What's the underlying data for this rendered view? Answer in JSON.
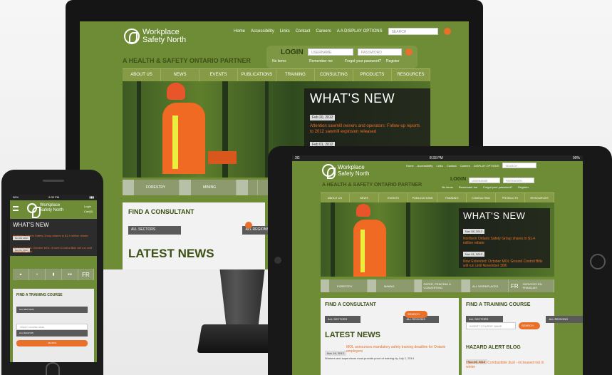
{
  "site": {
    "logo_line1": "Workplace",
    "logo_line2": "Safety North",
    "toplinks": [
      "Home",
      "Accessibility",
      "Links",
      "Contact",
      "Careers"
    ],
    "display_options": "DISPLAY OPTIONS",
    "search_placeholder": "SEARCH",
    "tagline": "A HEALTH & SAFETY ONTARIO PARTNER",
    "login": "LOGIN",
    "username": "USERNAME",
    "password": "PASSWORD",
    "no_items": "No items",
    "remember": "Remember me",
    "forgot": "Forgot your password?",
    "register": "Register",
    "nav": [
      "ABOUT US",
      "NEWS",
      "EVENTS",
      "PUBLICATIONS",
      "TRAINING",
      "CONSULTING",
      "PRODUCTS",
      "RESOURCES"
    ],
    "whats_new": "WHAT'S NEW",
    "news": [
      {
        "date": "Feb 20, 2012",
        "text": "Attention sawmill owners and operators: Follow-up reports to 2012 sawmill explosion released"
      },
      {
        "date": "Feb 01, 2012",
        "text": ""
      }
    ],
    "tablet_news": [
      {
        "date": "Nov 08, 2012",
        "text": "Northern Ontario Safety Group shares in $1.4 million rebate"
      },
      {
        "date": "Nov 01, 2012",
        "text": "Now Extended: October MOL Ground Control Blitz will run until November 30th"
      }
    ],
    "categories": [
      "FORESTRY",
      "MINING",
      "PAPER, PRINTING & CONVERTING",
      "ALL WORKPLACES",
      "SERVICES EN FRANÇAIS"
    ],
    "fr": "FR",
    "consultant_title": "FIND A CONSULTANT",
    "all_sectors": "ALL SECTORS",
    "all_regions": "ALL REGIONS",
    "search_btn": "SEARCH",
    "training_title": "FIND A TRAINING COURSE",
    "course_name": "INSERT COURSE NAME",
    "latest_news": "LATEST NEWS",
    "latest_item": {
      "date": "Nov 16, 2012",
      "text": "MOL announces mandatory safety training deadline for Ontario employers",
      "sub": "Workers and supervisors must provide proof of training by July 1, 2014"
    },
    "hazard_title": "HAZARD ALERT BLOG",
    "hazard_item": {
      "date": "Nov 06, 2012",
      "text": "Hazard Alert: Combustible dust - increased risk in winter"
    },
    "status_tablet": {
      "carrier": "3G",
      "time": "8:33 PM",
      "battery": "90%"
    },
    "status_phone": {
      "carrier": "96%",
      "time": "8:33 PM"
    },
    "phone_links": [
      "Login",
      "Cart(0)"
    ]
  },
  "colors": {
    "site_green": "#6e8b36",
    "accent_orange": "#e8702a",
    "dark_green": "#3d5016"
  },
  "icons": [
    "search-icon",
    "logo-icon",
    "hard-hat-icon",
    "tree-icon",
    "document-icon",
    "people-icon",
    "menu-icon",
    "chevron-down-icon",
    "arrow-right-icon"
  ]
}
